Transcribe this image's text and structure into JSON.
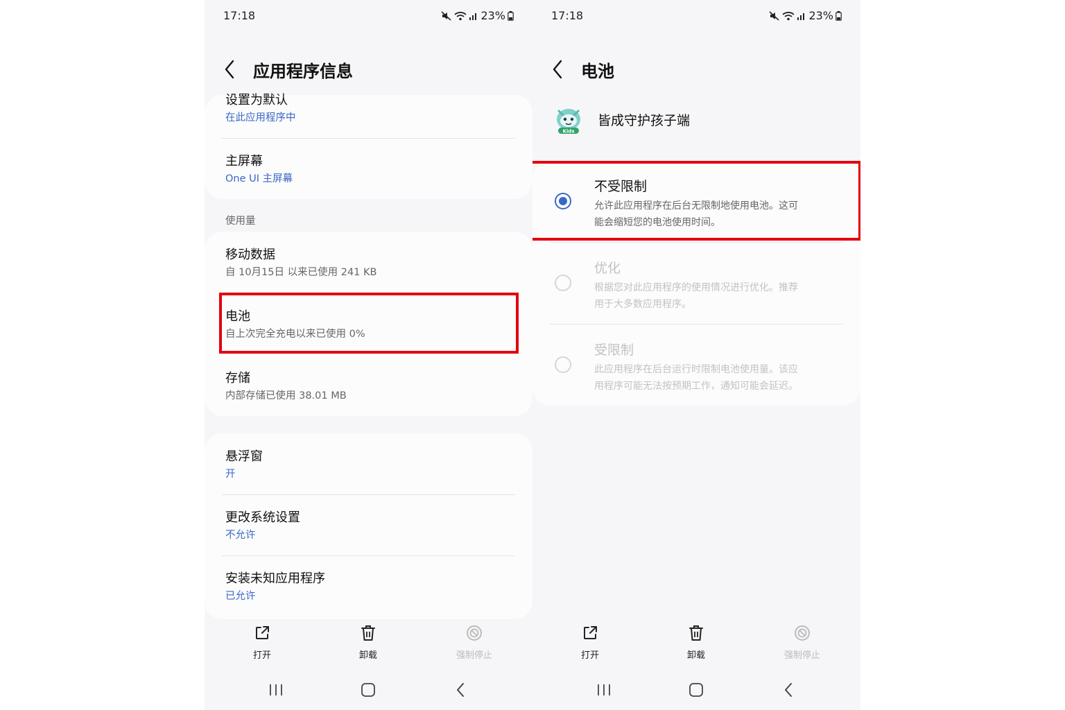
{
  "left": {
    "status": {
      "time": "17:18",
      "battery": "23%"
    },
    "header": {
      "title": "应用程序信息"
    },
    "default_group": {
      "set_default": {
        "title": "设置为默认",
        "value": "在此应用程序中"
      },
      "home_screen": {
        "title": "主屏幕",
        "value": "One UI 主屏幕"
      }
    },
    "usage_section_label": "使用量",
    "usage": {
      "mobile_data": {
        "title": "移动数据",
        "value": "自 10月15日 以来已使用 241 KB"
      },
      "battery": {
        "title": "电池",
        "value": "自上次完全充电以来已使用 0%"
      },
      "storage": {
        "title": "存储",
        "value": "内部存储已使用 38.01 MB"
      }
    },
    "permissions": {
      "floating_window": {
        "title": "悬浮窗",
        "value": "开"
      },
      "modify_settings": {
        "title": "更改系统设置",
        "value": "不允许"
      },
      "install_unknown": {
        "title": "安装未知应用程序",
        "value": "已允许"
      }
    },
    "actions": {
      "open": "打开",
      "uninstall": "卸载",
      "force_stop": "强制停止"
    }
  },
  "right": {
    "status": {
      "time": "17:18",
      "battery": "23%"
    },
    "header": {
      "title": "电池"
    },
    "app": {
      "name": "皆成守护孩子端",
      "icon_badge": "Kids"
    },
    "options": [
      {
        "title": "不受限制",
        "desc_line1": "允许此应用程序在后台无限制地使用电池。这可",
        "desc_line2": "能会缩短您的电池使用时间。",
        "selected": true
      },
      {
        "title": "优化",
        "desc_line1": "根据您对此应用程序的使用情况进行优化。推荐",
        "desc_line2": "用于大多数应用程序。",
        "selected": false
      },
      {
        "title": "受限制",
        "desc_line1": "此应用程序在后台运行时限制电池使用量。该应",
        "desc_line2": "用程序可能无法按预期工作，通知可能会延迟。",
        "selected": false
      }
    ],
    "actions": {
      "open": "打开",
      "uninstall": "卸载",
      "force_stop": "强制停止"
    }
  },
  "colors": {
    "accent": "#3a67c4",
    "highlight": "#e3000f",
    "background": "#f6f6f8",
    "card": "#fcfcfd"
  },
  "icons": [
    "back-icon",
    "mute-icon",
    "wifi-icon",
    "signal-icon",
    "battery-icon",
    "open-icon",
    "trash-icon",
    "block-icon",
    "recent-apps-icon",
    "home-icon",
    "nav-back-icon",
    "app-logo-icon"
  ]
}
